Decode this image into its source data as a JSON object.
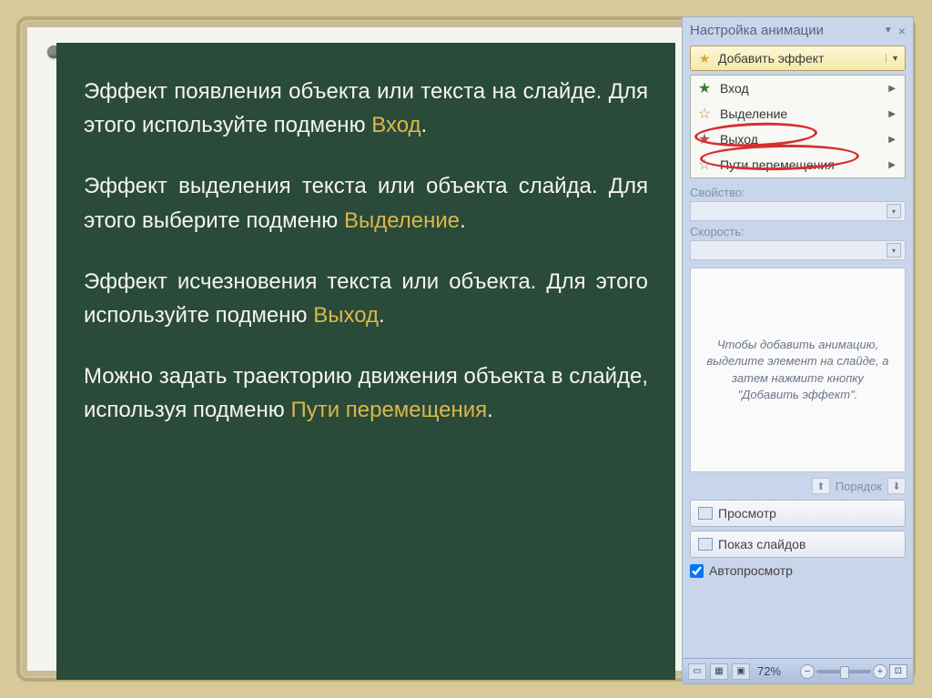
{
  "board": {
    "p1a": "Эффект появления объекта или текста на слайде. Для этого используйте подменю ",
    "p1h": "Вход",
    "p2a": "Эффект выделения текста или объекта слайда. Для этого выберите подменю ",
    "p2h": "Выделение",
    "p3a": "Эффект исчезновения текста или объекта. Для этого используйте подменю ",
    "p3h": "Выход",
    "p4a": "Можно задать траекторию движения объекта в слайде, используя подменю ",
    "p4h": "Пути перемещения",
    "dot": "."
  },
  "panel": {
    "title": "Настройка анимации",
    "add_effect": "Добавить эффект",
    "submenu": {
      "entry": "Вход",
      "emphasis": "Выделение",
      "exit": "Выход",
      "motion": "Пути перемещения"
    },
    "field_property": "Свойство:",
    "field_speed": "Скорость:",
    "preview_hint": "Чтобы добавить анимацию, выделите элемент на слайде, а затем нажмите кнопку \"Добавить эффект\".",
    "order_label": "Порядок",
    "btn_preview": "Просмотр",
    "btn_slideshow": "Показ слайдов",
    "chk_autopreview": "Автопросмотр"
  },
  "status": {
    "zoom": "72%"
  }
}
